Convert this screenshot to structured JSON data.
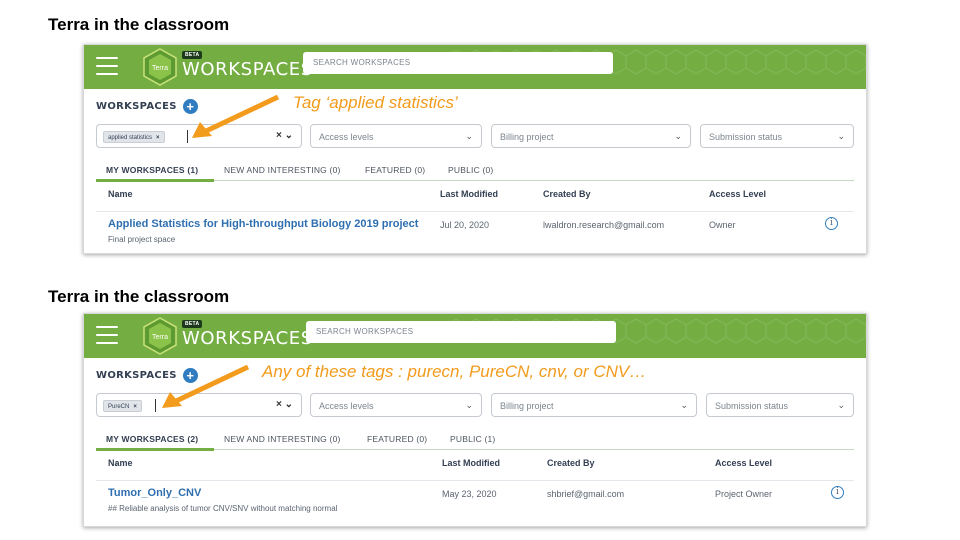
{
  "panels": [
    {
      "slide_title": "Terra in the classroom",
      "topbar": {
        "brand": "WORKSPACES",
        "logo_text": "Terra",
        "beta_badge": "BETA",
        "search_placeholder": "SEARCH WORKSPACES"
      },
      "section_label": "WORKSPACES",
      "filters": {
        "tag_chip": "applied statistics",
        "access_levels": "Access levels",
        "billing_project": "Billing project",
        "submission_status": "Submission status"
      },
      "tabs": [
        "MY WORKSPACES (1)",
        "NEW AND INTERESTING (0)",
        "FEATURED (0)",
        "PUBLIC (0)"
      ],
      "columns": [
        "Name",
        "Last Modified",
        "Created By",
        "Access Level"
      ],
      "rows": [
        {
          "name": "Applied Statistics for High-throughput Biology 2019 project",
          "description": "Final project space",
          "last_modified": "Jul 20, 2020",
          "created_by": "lwaldron.research@gmail.com",
          "access_level": "Owner"
        }
      ],
      "annotation": "Tag ‘applied statistics’"
    },
    {
      "slide_title": "Terra in the classroom",
      "topbar": {
        "brand": "WORKSPACES",
        "logo_text": "Terra",
        "beta_badge": "BETA",
        "search_placeholder": "SEARCH WORKSPACES"
      },
      "section_label": "WORKSPACES",
      "filters": {
        "tag_chip": "PureCN",
        "access_levels": "Access levels",
        "billing_project": "Billing project",
        "submission_status": "Submission status"
      },
      "tabs": [
        "MY WORKSPACES (2)",
        "NEW AND INTERESTING (0)",
        "FEATURED (0)",
        "PUBLIC (1)"
      ],
      "columns": [
        "Name",
        "Last Modified",
        "Created By",
        "Access Level"
      ],
      "rows": [
        {
          "name": "Tumor_Only_CNV",
          "description": "## Reliable analysis of tumor CNV/SNV without matching normal",
          "last_modified": "May 23, 2020",
          "created_by": "shbrief@gmail.com",
          "access_level": "Project Owner"
        }
      ],
      "annotation": "Any of these tags : purecn, PureCN, cnv, or CNV…"
    }
  ],
  "icons": {
    "menu": "hamburger-menu-icon",
    "add": "plus-circle-icon",
    "sort": "arrow-down-icon",
    "info": "info-circle-icon",
    "chevron": "chevron-down-icon",
    "clear": "close-icon"
  },
  "colors": {
    "topbar": "#74ae43",
    "link": "#2f6fb0",
    "accent_blue": "#2f7dc0",
    "annotation": "#f29b1c"
  }
}
